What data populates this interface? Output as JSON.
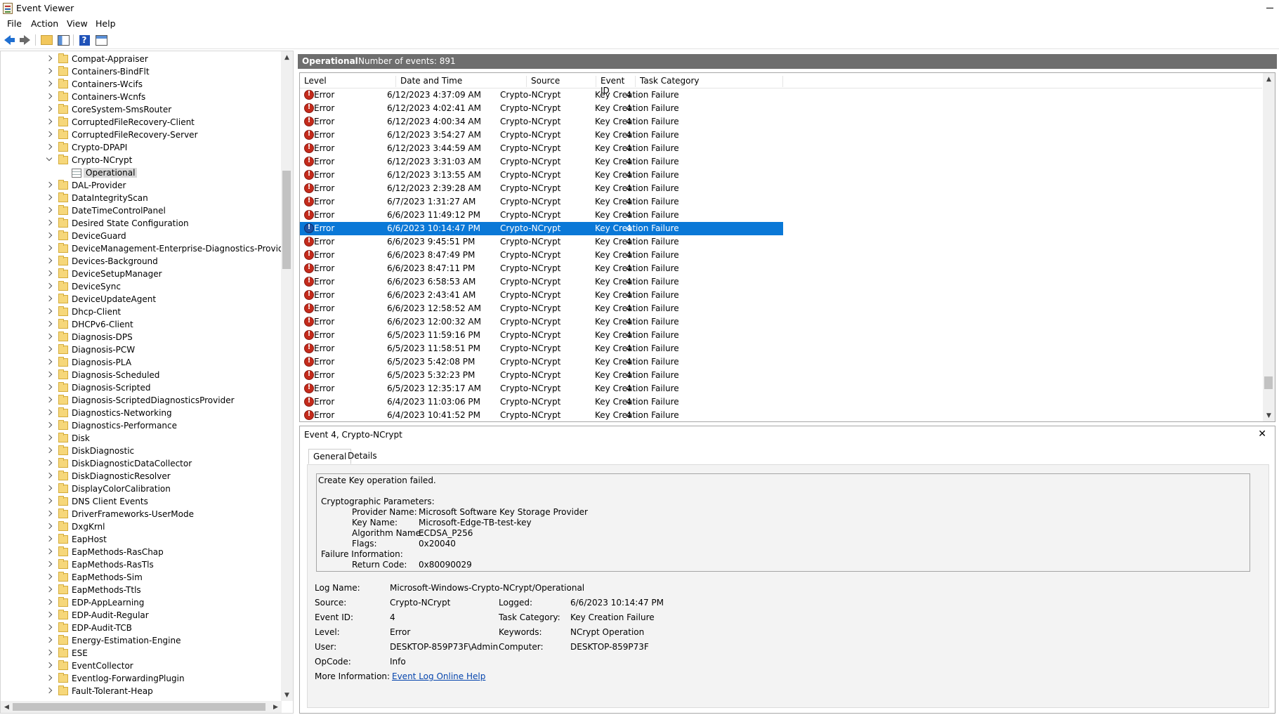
{
  "window": {
    "title": "Event Viewer"
  },
  "menu": [
    "File",
    "Action",
    "View",
    "Help"
  ],
  "toolbar": {
    "icons": [
      "back-arrow-icon",
      "forward-arrow-icon",
      "folder-up-icon",
      "show-hide-console-tree-icon",
      "help-icon",
      "show-hide-action-pane-icon"
    ]
  },
  "tree": {
    "items": [
      {
        "label": "Compat-Appraiser"
      },
      {
        "label": "Containers-BindFlt"
      },
      {
        "label": "Containers-Wcifs"
      },
      {
        "label": "Containers-Wcnfs"
      },
      {
        "label": "CoreSystem-SmsRouter"
      },
      {
        "label": "CorruptedFileRecovery-Client"
      },
      {
        "label": "CorruptedFileRecovery-Server"
      },
      {
        "label": "Crypto-DPAPI"
      },
      {
        "label": "Crypto-NCrypt",
        "expanded": true
      },
      {
        "label": "Operational",
        "child": true,
        "selected": true
      },
      {
        "label": "DAL-Provider"
      },
      {
        "label": "DataIntegrityScan"
      },
      {
        "label": "DateTimeControlPanel"
      },
      {
        "label": "Desired State Configuration"
      },
      {
        "label": "DeviceGuard"
      },
      {
        "label": "DeviceManagement-Enterprise-Diagnostics-Provider"
      },
      {
        "label": "Devices-Background"
      },
      {
        "label": "DeviceSetupManager"
      },
      {
        "label": "DeviceSync"
      },
      {
        "label": "DeviceUpdateAgent"
      },
      {
        "label": "Dhcp-Client"
      },
      {
        "label": "DHCPv6-Client"
      },
      {
        "label": "Diagnosis-DPS"
      },
      {
        "label": "Diagnosis-PCW"
      },
      {
        "label": "Diagnosis-PLA"
      },
      {
        "label": "Diagnosis-Scheduled"
      },
      {
        "label": "Diagnosis-Scripted"
      },
      {
        "label": "Diagnosis-ScriptedDiagnosticsProvider"
      },
      {
        "label": "Diagnostics-Networking"
      },
      {
        "label": "Diagnostics-Performance"
      },
      {
        "label": "Disk"
      },
      {
        "label": "DiskDiagnostic"
      },
      {
        "label": "DiskDiagnosticDataCollector"
      },
      {
        "label": "DiskDiagnosticResolver"
      },
      {
        "label": "DisplayColorCalibration"
      },
      {
        "label": "DNS Client Events"
      },
      {
        "label": "DriverFrameworks-UserMode"
      },
      {
        "label": "DxgKrnl"
      },
      {
        "label": "EapHost"
      },
      {
        "label": "EapMethods-RasChap"
      },
      {
        "label": "EapMethods-RasTls"
      },
      {
        "label": "EapMethods-Sim"
      },
      {
        "label": "EapMethods-Ttls"
      },
      {
        "label": "EDP-AppLearning"
      },
      {
        "label": "EDP-Audit-Regular"
      },
      {
        "label": "EDP-Audit-TCB"
      },
      {
        "label": "Energy-Estimation-Engine"
      },
      {
        "label": "ESE"
      },
      {
        "label": "EventCollector"
      },
      {
        "label": "Eventlog-ForwardingPlugin"
      },
      {
        "label": "Fault-Tolerant-Heap"
      }
    ]
  },
  "events_pane": {
    "log_name": "Operational",
    "count_text": "Number of events: 891",
    "columns": [
      "Level",
      "Date and Time",
      "Source",
      "Event ID",
      "Task Category"
    ],
    "rows": [
      [
        "Error",
        "6/12/2023 4:37:09 AM",
        "Crypto-NCrypt",
        "4",
        "Key Creation Failure"
      ],
      [
        "Error",
        "6/12/2023 4:02:41 AM",
        "Crypto-NCrypt",
        "4",
        "Key Creation Failure"
      ],
      [
        "Error",
        "6/12/2023 4:00:34 AM",
        "Crypto-NCrypt",
        "4",
        "Key Creation Failure"
      ],
      [
        "Error",
        "6/12/2023 3:54:27 AM",
        "Crypto-NCrypt",
        "4",
        "Key Creation Failure"
      ],
      [
        "Error",
        "6/12/2023 3:44:59 AM",
        "Crypto-NCrypt",
        "4",
        "Key Creation Failure"
      ],
      [
        "Error",
        "6/12/2023 3:31:03 AM",
        "Crypto-NCrypt",
        "4",
        "Key Creation Failure"
      ],
      [
        "Error",
        "6/12/2023 3:13:55 AM",
        "Crypto-NCrypt",
        "4",
        "Key Creation Failure"
      ],
      [
        "Error",
        "6/12/2023 2:39:28 AM",
        "Crypto-NCrypt",
        "4",
        "Key Creation Failure"
      ],
      [
        "Error",
        "6/7/2023 1:31:27 AM",
        "Crypto-NCrypt",
        "4",
        "Key Creation Failure"
      ],
      [
        "Error",
        "6/6/2023 11:49:12 PM",
        "Crypto-NCrypt",
        "4",
        "Key Creation Failure"
      ],
      [
        "Error",
        "6/6/2023 10:14:47 PM",
        "Crypto-NCrypt",
        "4",
        "Key Creation Failure"
      ],
      [
        "Error",
        "6/6/2023 9:45:51 PM",
        "Crypto-NCrypt",
        "4",
        "Key Creation Failure"
      ],
      [
        "Error",
        "6/6/2023 8:47:49 PM",
        "Crypto-NCrypt",
        "4",
        "Key Creation Failure"
      ],
      [
        "Error",
        "6/6/2023 8:47:11 PM",
        "Crypto-NCrypt",
        "4",
        "Key Creation Failure"
      ],
      [
        "Error",
        "6/6/2023 6:58:53 AM",
        "Crypto-NCrypt",
        "4",
        "Key Creation Failure"
      ],
      [
        "Error",
        "6/6/2023 2:43:41 AM",
        "Crypto-NCrypt",
        "4",
        "Key Creation Failure"
      ],
      [
        "Error",
        "6/6/2023 12:58:52 AM",
        "Crypto-NCrypt",
        "4",
        "Key Creation Failure"
      ],
      [
        "Error",
        "6/6/2023 12:00:32 AM",
        "Crypto-NCrypt",
        "4",
        "Key Creation Failure"
      ],
      [
        "Error",
        "6/5/2023 11:59:16 PM",
        "Crypto-NCrypt",
        "4",
        "Key Creation Failure"
      ],
      [
        "Error",
        "6/5/2023 11:58:51 PM",
        "Crypto-NCrypt",
        "4",
        "Key Creation Failure"
      ],
      [
        "Error",
        "6/5/2023 5:42:08 PM",
        "Crypto-NCrypt",
        "4",
        "Key Creation Failure"
      ],
      [
        "Error",
        "6/5/2023 5:32:23 PM",
        "Crypto-NCrypt",
        "4",
        "Key Creation Failure"
      ],
      [
        "Error",
        "6/5/2023 12:35:17 AM",
        "Crypto-NCrypt",
        "4",
        "Key Creation Failure"
      ],
      [
        "Error",
        "6/4/2023 11:03:06 PM",
        "Crypto-NCrypt",
        "4",
        "Key Creation Failure"
      ],
      [
        "Error",
        "6/4/2023 10:41:52 PM",
        "Crypto-NCrypt",
        "4",
        "Key Creation Failure"
      ]
    ],
    "selected_row": 10
  },
  "detail": {
    "title": "Event 4, Crypto-NCrypt",
    "close_glyph": "✕",
    "tabs": [
      "General",
      "Details"
    ],
    "active_tab": "General",
    "message": {
      "line1": "Create Key operation failed.",
      "crypto_header": "Cryptographic Parameters:",
      "params": [
        {
          "k": "Provider Name:",
          "v": "Microsoft Software Key Storage Provider"
        },
        {
          "k": "Key Name:",
          "v": "Microsoft-Edge-TB-test-key"
        },
        {
          "k": "Algorithm Name:",
          "v": "ECDSA_P256"
        },
        {
          "k": "Flags:",
          "v": "0x20040"
        }
      ],
      "failure_header": "Failure Information:",
      "failure": [
        {
          "k": "Return Code:",
          "v": "0x80090029"
        }
      ]
    },
    "fields": {
      "log_name_label": "Log Name:",
      "log_name": "Microsoft-Windows-Crypto-NCrypt/Operational",
      "source_label": "Source:",
      "source": "Crypto-NCrypt",
      "logged_label": "Logged:",
      "logged": "6/6/2023 10:14:47 PM",
      "event_id_label": "Event ID:",
      "event_id": "4",
      "task_category_label": "Task Category:",
      "task_category": "Key Creation Failure",
      "level_label": "Level:",
      "level": "Error",
      "keywords_label": "Keywords:",
      "keywords": "NCrypt Operation",
      "user_label": "User:",
      "user": "DESKTOP-859P73F\\Admin",
      "computer_label": "Computer:",
      "computer": "DESKTOP-859P73F",
      "opcode_label": "OpCode:",
      "opcode": "Info",
      "more_info_label": "More Information:",
      "more_info_link": "Event Log Online Help"
    }
  },
  "colors": {
    "selection": "#0a78d7",
    "header_bar": "#6e6e6e",
    "error_icon": "#c42b1c",
    "link": "#0645ad"
  }
}
